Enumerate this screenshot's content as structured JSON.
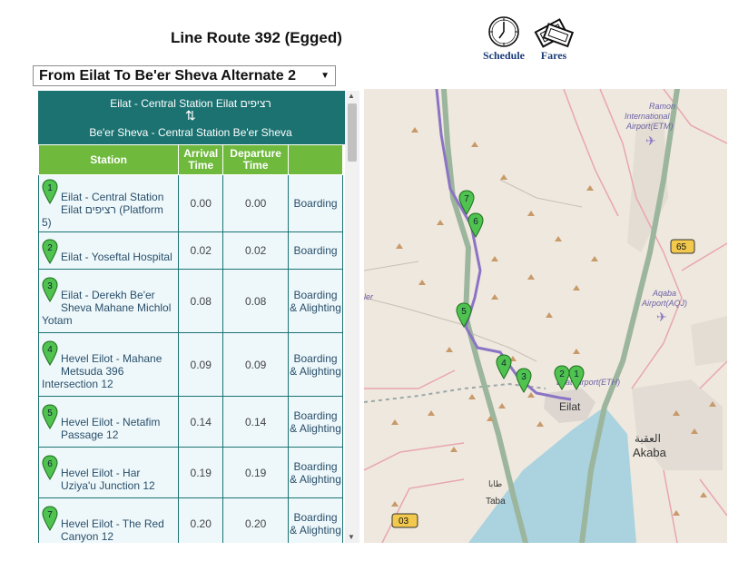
{
  "page": {
    "title": "Line Route 392 (Egged)"
  },
  "toolbar": {
    "schedule_label": "Schedule",
    "schedule_icon": "clock-icon",
    "fares_label": "Fares",
    "fares_icon": "ticket-icon"
  },
  "route_select": {
    "selected": "From Eilat To Be'er Sheva Alternate 2"
  },
  "route_header": {
    "origin": "Eilat - Central Station Eilat רציפים",
    "destination": "Be'er Sheva - Central Station Be'er Sheva"
  },
  "table": {
    "headers": {
      "station": "Station",
      "arrival": "Arrival Time",
      "departure": "Departure Time",
      "action": ""
    },
    "rows": [
      {
        "num": "1",
        "station": "Eilat - Central Station Eilat רציפים (Platform 5)",
        "arrival": "0.00",
        "departure": "0.00",
        "action": "Boarding"
      },
      {
        "num": "2",
        "station": "Eilat - Yoseftal Hospital",
        "arrival": "0.02",
        "departure": "0.02",
        "action": "Boarding"
      },
      {
        "num": "3",
        "station": "Eilat - Derekh Be'er Sheva Mahane Michlol Yotam",
        "arrival": "0.08",
        "departure": "0.08",
        "action": "Boarding & Alighting"
      },
      {
        "num": "4",
        "station": "Hevel Eilot - Mahane Metsuda 396 Intersection 12",
        "arrival": "0.09",
        "departure": "0.09",
        "action": "Boarding & Alighting"
      },
      {
        "num": "5",
        "station": "Hevel Eilot - Netafim Passage 12",
        "arrival": "0.14",
        "departure": "0.14",
        "action": "Boarding & Alighting"
      },
      {
        "num": "6",
        "station": "Hevel Eilot - Har Uziya'u Junction 12",
        "arrival": "0.19",
        "departure": "0.19",
        "action": "Boarding & Alighting"
      },
      {
        "num": "7",
        "station": "Hevel Eilot - The Red Canyon 12",
        "arrival": "0.20",
        "departure": "0.20",
        "action": "Boarding & Alighting"
      }
    ]
  },
  "map": {
    "labels": {
      "ramon": "Ramon",
      "ramon2": "International",
      "ramon3": "Airport(ETM)",
      "aqaba_airport": "Aqaba",
      "aqaba_airport2": "Airport(AQJ)",
      "eilat_airport": "Eilat Airport(ETH)",
      "eilat": "Eilat",
      "aqaba_ar": "العقبة",
      "aqaba": "Akaba",
      "taba_ar": "طابا",
      "taba": "Taba",
      "edge": "ler"
    },
    "shields": {
      "r65": "65",
      "r03": "03"
    },
    "markers": [
      "1",
      "2",
      "3",
      "4",
      "5",
      "6",
      "7"
    ],
    "colors": {
      "water": "#aad3df",
      "route": "#8b74c4",
      "highway": "#8fa690",
      "marker": "#4fc24f"
    }
  }
}
